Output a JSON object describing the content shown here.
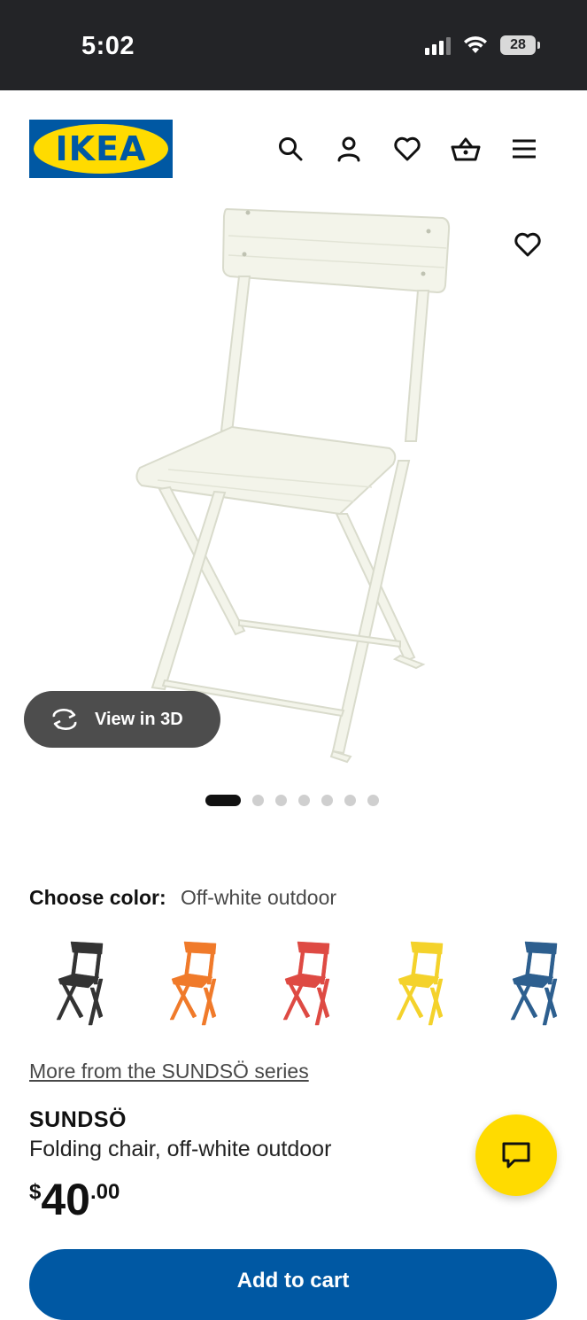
{
  "status_bar": {
    "time": "5:02",
    "battery": "28"
  },
  "header": {
    "logo_text": "IKEA"
  },
  "icons": {
    "search": "search-icon",
    "account": "user-icon",
    "wishlist": "heart-icon",
    "cart": "basket-icon",
    "menu": "hamburger-menu-icon",
    "view3d": "rotate-3d-icon",
    "chat": "chat-bubble-icon"
  },
  "gallery": {
    "view3d_label": "View in 3D",
    "image_count": 7,
    "active_index": 0
  },
  "color_picker": {
    "label": "Choose color:",
    "selected": "Off-white outdoor",
    "options": [
      {
        "name": "black",
        "color": "#333333"
      },
      {
        "name": "orange",
        "color": "#f07a2a"
      },
      {
        "name": "red",
        "color": "#de4a43"
      },
      {
        "name": "yellow",
        "color": "#f4d22b"
      },
      {
        "name": "blue",
        "color": "#2d5f8f"
      }
    ]
  },
  "product": {
    "series_link": "More from the SUNDSÖ series",
    "name": "SUNDSÖ",
    "description": "Folding chair, off-white outdoor",
    "price_currency": "$",
    "price_integer": "40",
    "price_decimal": ".00",
    "add_to_cart": "Add to cart"
  },
  "colors": {
    "ikea_blue": "#0058a3",
    "ikea_yellow": "#ffdb00",
    "status_bar_bg": "#232427",
    "chair_offwhite": "#f3f4ea"
  }
}
